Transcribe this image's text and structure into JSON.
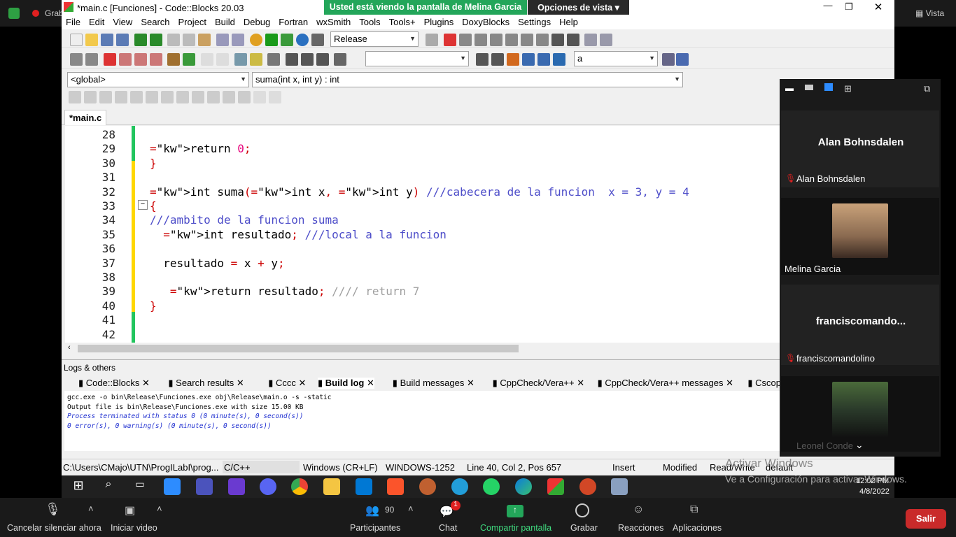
{
  "zoom_top": {
    "recording": "Grab",
    "view_label": "Vista"
  },
  "banner": {
    "sharing_text": "Usted está viendo la pantalla de Melina Garcia",
    "view_options": "Opciones de vista"
  },
  "window": {
    "title": "*main.c [Funciones] - Code::Blocks 20.03"
  },
  "menu": [
    "File",
    "Edit",
    "View",
    "Search",
    "Project",
    "Build",
    "Debug",
    "Fortran",
    "wxSmith",
    "Tools",
    "Tools+",
    "Plugins",
    "DoxyBlocks",
    "Settings",
    "Help"
  ],
  "build_target": "Release",
  "search_combo": "a",
  "scope_combo": "<global>",
  "function_combo": "suma(int x, int y) : int",
  "tab": "*main.c",
  "lines": [
    {
      "n": "28",
      "code": ""
    },
    {
      "n": "29",
      "code": "return 0;"
    },
    {
      "n": "30",
      "code": "}"
    },
    {
      "n": "31",
      "code": ""
    },
    {
      "n": "32",
      "code": "int suma(int x, int y) ///cabecera de la funcion  x = 3, y = 4"
    },
    {
      "n": "33",
      "code": "{"
    },
    {
      "n": "34",
      "code": "///ambito de la funcion suma"
    },
    {
      "n": "35",
      "code": "  int resultado; ///local a la funcion"
    },
    {
      "n": "36",
      "code": ""
    },
    {
      "n": "37",
      "code": "  resultado = x + y;"
    },
    {
      "n": "38",
      "code": ""
    },
    {
      "n": "39",
      "code": "   return resultado; //// return 7"
    },
    {
      "n": "40",
      "code": "}"
    },
    {
      "n": "41",
      "code": ""
    },
    {
      "n": "42",
      "code": ""
    }
  ],
  "logs": {
    "title": "Logs & others",
    "tabs": [
      "Code::Blocks",
      "Search results",
      "Cccc",
      "Build log",
      "Build messages",
      "CppCheck/Vera++",
      "CppCheck/Vera++ messages",
      "Cscope"
    ],
    "output": [
      "gcc.exe  -o bin\\Release\\Funciones.exe obj\\Release\\main.o  -s -static",
      "Output file is bin\\Release\\Funciones.exe with size 15.00 KB",
      "Process terminated with status 0 (0 minute(s), 0 second(s))",
      "0 error(s), 0 warning(s) (0 minute(s), 0 second(s))"
    ]
  },
  "status": {
    "path": "C:\\Users\\CMajo\\UTN\\ProgILabI\\prog...",
    "lang": "C/C++",
    "eol": "Windows (CR+LF)",
    "encoding": "WINDOWS-1252",
    "pos": "Line 40, Col 2, Pos 657",
    "mode": "Insert",
    "modified": "Modified",
    "rw": "Read/Write",
    "def": "default"
  },
  "participants": [
    {
      "display": "Alan Bohnsdalen",
      "label": "Alan Bohnsdalen",
      "muted": true
    },
    {
      "display": "",
      "label": "Melina Garcia",
      "muted": false
    },
    {
      "display": "franciscomando...",
      "label": "franciscomandolino",
      "muted": true
    },
    {
      "display": "",
      "label": "Leonel Conde",
      "muted": false
    }
  ],
  "activate": {
    "line1": "Activar Windows",
    "line2": "Ve a Configuración para activar Windows."
  },
  "clock": {
    "time": "12:02 PM",
    "date": "4/8/2022"
  },
  "zoom_controls": {
    "mute": "Cancelar silenciar ahora",
    "video": "Iniciar video",
    "participants": "Participantes",
    "participants_count": "90",
    "chat": "Chat",
    "chat_badge": "1",
    "share": "Compartir pantalla",
    "record": "Grabar",
    "reactions": "Reacciones",
    "apps": "Aplicaciones",
    "leave": "Salir"
  },
  "colors": {
    "share_green": "#23a65a",
    "leave_red": "#c92a2a",
    "zoom_bg": "#1a1a1a"
  }
}
